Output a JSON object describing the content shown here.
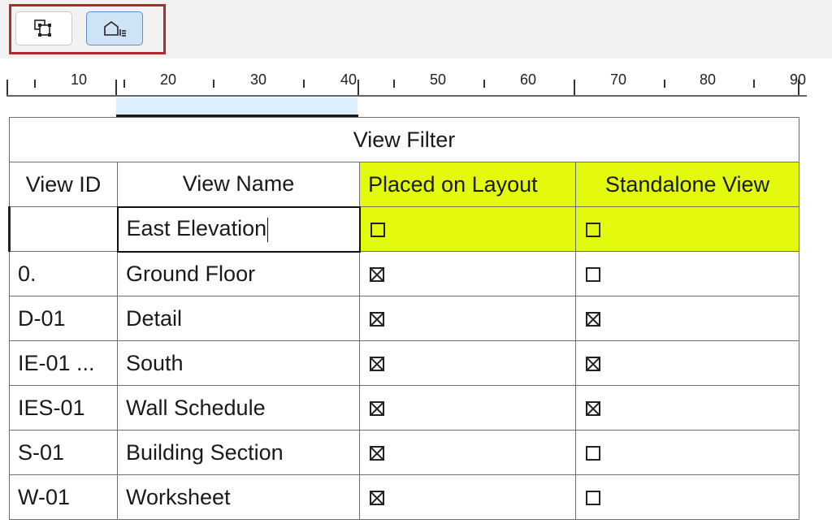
{
  "toolbar": {
    "buttons": [
      {
        "icon": "drawing-frame-icon",
        "selected": false
      },
      {
        "icon": "view-list-icon",
        "selected": true
      }
    ],
    "highlight_color": "#b32a2a"
  },
  "ruler": {
    "labels": [
      "10",
      "20",
      "30",
      "40",
      "50",
      "60",
      "70",
      "80",
      "90"
    ]
  },
  "table": {
    "title": "View Filter",
    "headers": [
      "View ID",
      "View Name",
      "Placed on Layout",
      "Standalone View"
    ],
    "filter": {
      "view_id": "",
      "view_name": "East Elevation",
      "placed_on_layout": false,
      "standalone_view": false
    },
    "rows": [
      {
        "id": "0.",
        "name": "Ground Floor",
        "placed": true,
        "standalone": false
      },
      {
        "id": "D-01",
        "name": "Detail",
        "placed": true,
        "standalone": true
      },
      {
        "id": "IE-01 ...",
        "name": "South",
        "placed": true,
        "standalone": true
      },
      {
        "id": "IES-01",
        "name": "Wall Schedule",
        "placed": true,
        "standalone": true
      },
      {
        "id": "S-01",
        "name": "Building Section",
        "placed": true,
        "standalone": false
      },
      {
        "id": "W-01",
        "name": "Worksheet",
        "placed": true,
        "standalone": false
      }
    ],
    "highlight_color": "#e3fa0f"
  }
}
